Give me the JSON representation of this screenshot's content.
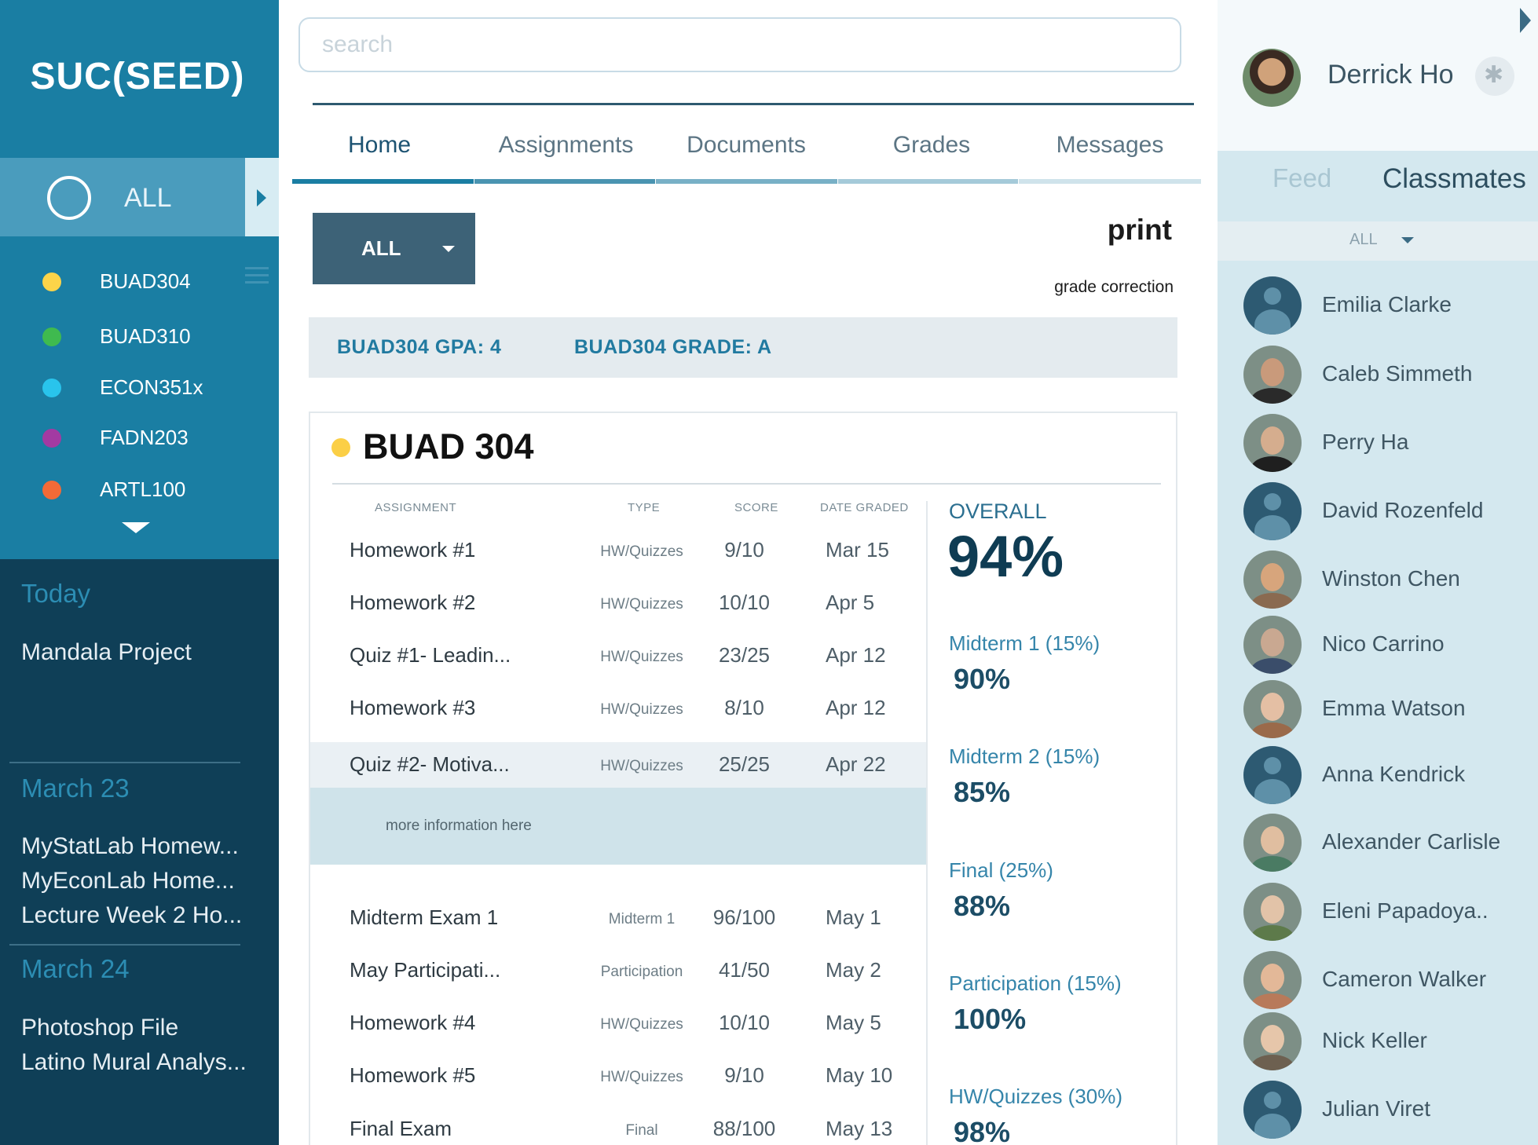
{
  "sidebar": {
    "logo": "SUC(SEED)",
    "all_label": "ALL",
    "courses": [
      {
        "name": "BUAD304",
        "color": "#fcd449"
      },
      {
        "name": "BUAD310",
        "color": "#3fba4f"
      },
      {
        "name": "ECON351x",
        "color": "#29c4ec"
      },
      {
        "name": "FADN203",
        "color": "#a33aa2"
      },
      {
        "name": "ARTL100",
        "color": "#f36a37"
      }
    ],
    "sections": [
      {
        "date": "Today",
        "items": [
          "Mandala Project"
        ]
      },
      {
        "date": "March 23",
        "items": [
          "MyStatLab Homew...",
          "MyEconLab Home...",
          "Lecture Week 2 Ho..."
        ]
      },
      {
        "date": "March 24",
        "items": [
          "Photoshop File",
          "Latino Mural Analys..."
        ]
      }
    ]
  },
  "search": {
    "placeholder": "search"
  },
  "tabs": [
    "Home",
    "Assignments",
    "Documents",
    "Grades",
    "Messages"
  ],
  "toolbar": {
    "filter_label": "ALL",
    "print_label": "print",
    "grade_correction_label": "grade correction"
  },
  "summary": {
    "gpa": "BUAD304 GPA: 4",
    "grade": "BUAD304 GRADE: A"
  },
  "course": {
    "title": "BUAD 304",
    "color": "#fbcf46",
    "headers": [
      "ASSIGNMENT",
      "TYPE",
      "SCORE",
      "DATE GRADED"
    ],
    "rows": [
      [
        "Homework #1",
        "HW/Quizzes",
        "9/10",
        "Mar 15"
      ],
      [
        "Homework #2",
        "HW/Quizzes",
        "10/10",
        "Apr 5"
      ],
      [
        "Quiz #1- Leadin...",
        "HW/Quizzes",
        "23/25",
        "Apr 12"
      ],
      [
        "Homework #3",
        "HW/Quizzes",
        "8/10",
        "Apr 12"
      ],
      [
        "Quiz #2- Motiva...",
        "HW/Quizzes",
        "25/25",
        "Apr 22"
      ],
      [
        "Midterm Exam 1",
        "Midterm 1",
        "96/100",
        "May 1"
      ],
      [
        "May Participati...",
        "Participation",
        "41/50",
        "May 2"
      ],
      [
        "Homework #4",
        "HW/Quizzes",
        "10/10",
        "May 5"
      ],
      [
        "Homework #5",
        "HW/Quizzes",
        "9/10",
        "May 10"
      ],
      [
        "Final Exam",
        "Final",
        "88/100",
        "May 13"
      ]
    ],
    "more_info": "more information here",
    "overall_label": "OVERALL",
    "overall_value": "94%",
    "categories": [
      {
        "label": "Midterm 1 (15%)",
        "value": "90%"
      },
      {
        "label": "Midterm 2 (15%)",
        "value": "85%"
      },
      {
        "label": "Final (25%)",
        "value": "88%"
      },
      {
        "label": "Participation (15%)",
        "value": "100%"
      },
      {
        "label": "HW/Quizzes (30%)",
        "value": "98%"
      }
    ]
  },
  "user": {
    "name": "Derrick Ho"
  },
  "right_panel": {
    "tabs": [
      "Feed",
      "Classmates"
    ],
    "filter_label": "ALL",
    "classmates": [
      {
        "name": "Emilia Clarke",
        "avatar": "generic"
      },
      {
        "name": "Caleb Simmeth",
        "avatar": "photo",
        "skin": "#c99a7b",
        "shirt": "#2a2a2a"
      },
      {
        "name": "Perry Ha",
        "avatar": "photo",
        "skin": "#d5ad8e",
        "shirt": "#1f1f1f"
      },
      {
        "name": "David Rozenfeld",
        "avatar": "generic"
      },
      {
        "name": "Winston Chen",
        "avatar": "photo",
        "skin": "#d7a57c",
        "shirt": "#8a6a50"
      },
      {
        "name": "Nico Carrino",
        "avatar": "photo",
        "skin": "#c9a891",
        "shirt": "#3a4d6a"
      },
      {
        "name": "Emma Watson",
        "avatar": "photo",
        "skin": "#e4bfa4",
        "shirt": "#9a6a4a"
      },
      {
        "name": "Anna Kendrick",
        "avatar": "generic"
      },
      {
        "name": "Alexander Carlisle",
        "avatar": "photo",
        "skin": "#e0bea0",
        "shirt": "#4a7b63"
      },
      {
        "name": "Eleni Papadoya..",
        "avatar": "photo",
        "skin": "#e2c3a8",
        "shirt": "#5d7a4a"
      },
      {
        "name": "Cameron Walker",
        "avatar": "photo",
        "skin": "#e3b898",
        "shirt": "#b87a5a"
      },
      {
        "name": "Nick Keller",
        "avatar": "photo",
        "skin": "#e6c6aa",
        "shirt": "#6d6050"
      },
      {
        "name": "Julian Viret",
        "avatar": "generic"
      }
    ]
  }
}
